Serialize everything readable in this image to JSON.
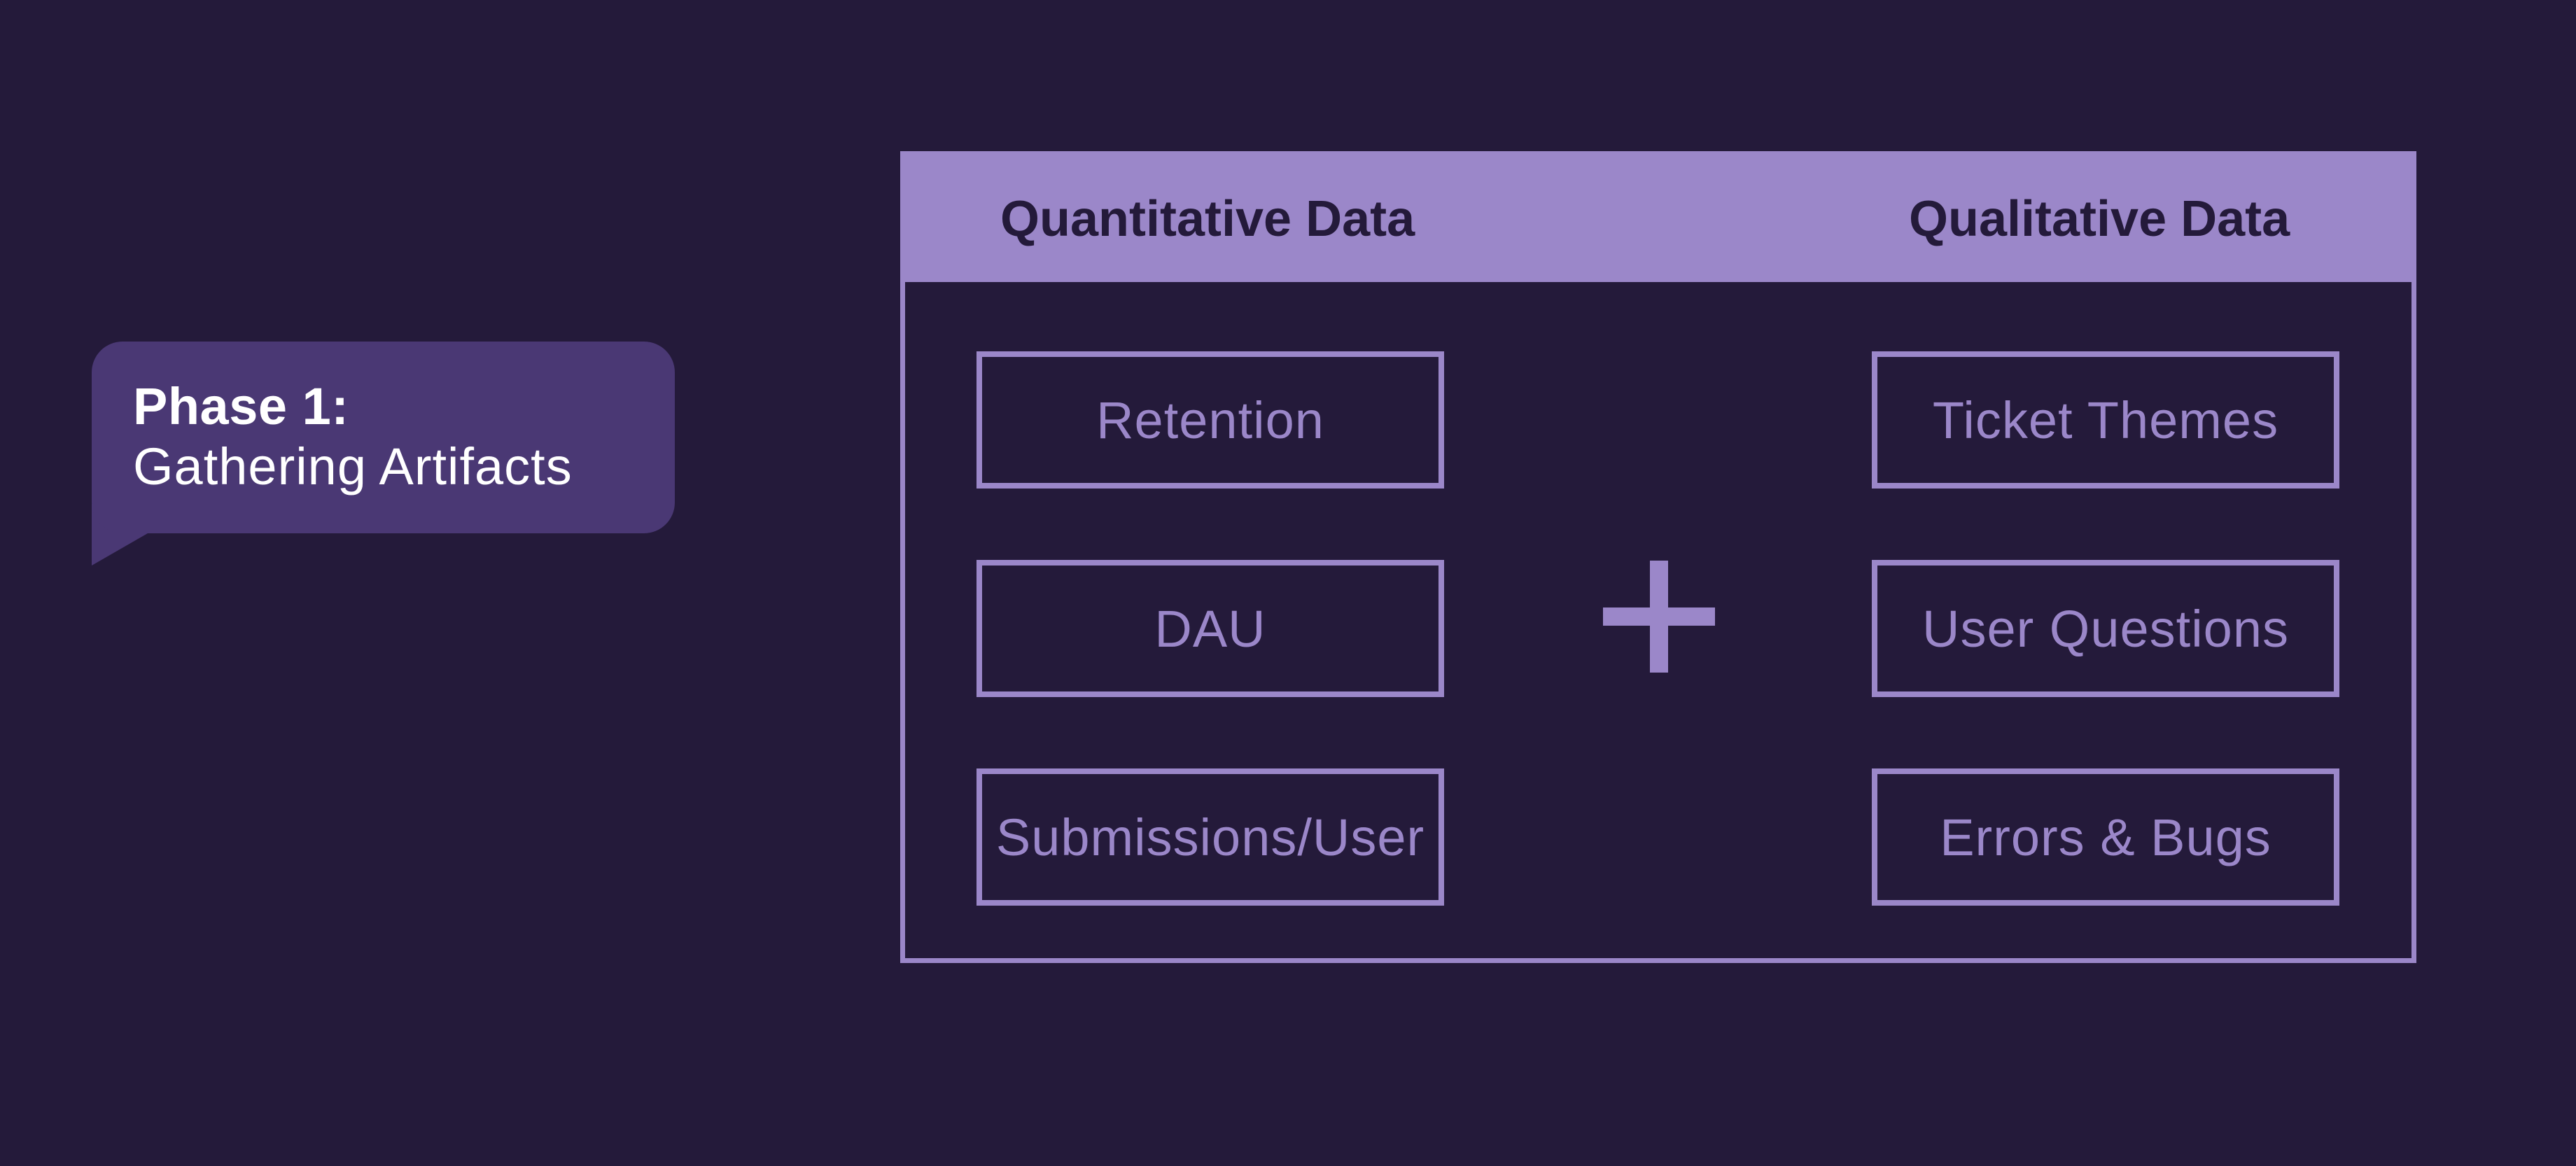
{
  "colors": {
    "background": "#241a3a",
    "bubble_fill": "#4a3874",
    "bubble_text": "#ffffff",
    "accent": "#9b87c9",
    "header_text": "#241a3a"
  },
  "callout": {
    "title": "Phase 1:",
    "subtitle": "Gathering Artifacts"
  },
  "panel": {
    "left_header": "Quantitative Data",
    "right_header": "Qualitative Data",
    "operator_icon": "plus-icon",
    "quantitative_items": [
      "Retention",
      "DAU",
      "Submissions/User"
    ],
    "qualitative_items": [
      "Ticket Themes",
      "User Questions",
      "Errors & Bugs"
    ]
  }
}
